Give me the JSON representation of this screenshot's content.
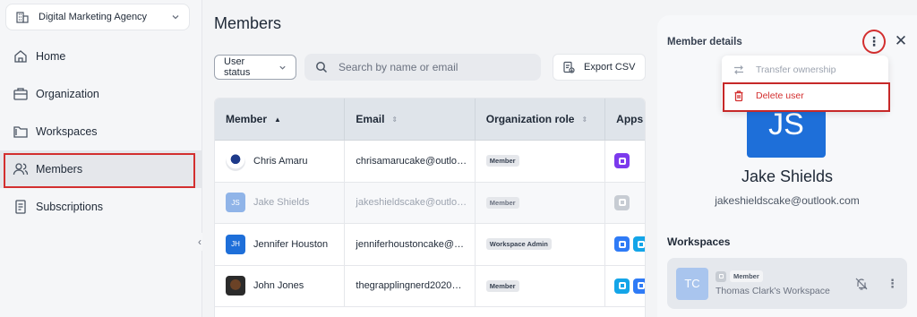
{
  "sidebar": {
    "org_name": "Digital Marketing Agency",
    "items": [
      {
        "label": "Home",
        "icon": "home-icon"
      },
      {
        "label": "Organization",
        "icon": "briefcase-icon"
      },
      {
        "label": "Workspaces",
        "icon": "folder-icon"
      },
      {
        "label": "Members",
        "icon": "users-icon",
        "active": true
      },
      {
        "label": "Subscriptions",
        "icon": "receipt-icon"
      }
    ]
  },
  "main": {
    "title": "Members",
    "status_filter": "User status",
    "search_placeholder": "Search by name or email",
    "export_label": "Export CSV",
    "columns": [
      "Member",
      "Email",
      "Organization role",
      "Apps"
    ],
    "rows": [
      {
        "name": "Chris Amaru",
        "email": "chrisamarucake@outlook...",
        "role": "Member",
        "avatar": ""
      },
      {
        "name": "Jake Shields",
        "email": "jakeshieldscake@outlook...",
        "role": "Member",
        "avatar": "JS"
      },
      {
        "name": "Jennifer Houston",
        "email": "jenniferhoustoncake@out...",
        "role": "Workspace Admin",
        "avatar": "JH"
      },
      {
        "name": "John Jones",
        "email": "thegrapplingnerd2020@g...",
        "role": "Member",
        "avatar": ""
      }
    ]
  },
  "details": {
    "title": "Member details",
    "avatar_initials": "JS",
    "name": "Jake Shields",
    "email": "jakeshieldscake@outlook.com",
    "workspaces_title": "Workspaces",
    "workspace": {
      "initials": "TC",
      "role": "Member",
      "name": "Thomas Clark's Workspace"
    }
  },
  "menu": {
    "transfer_label": "Transfer ownership",
    "delete_label": "Delete user"
  },
  "colors": {
    "accent": "#1e6fd9",
    "danger": "#d32f2f"
  }
}
